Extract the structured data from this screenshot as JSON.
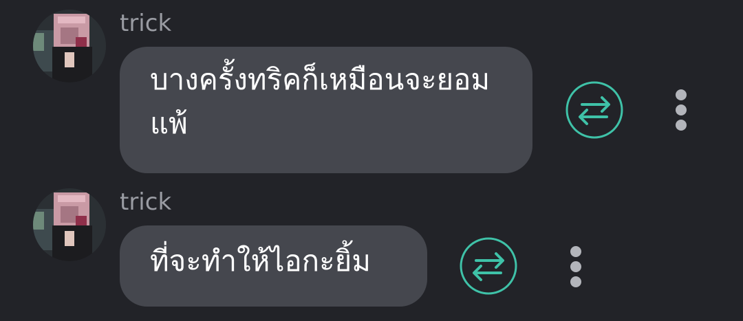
{
  "messages": [
    {
      "sender": "trick",
      "text": "บางครั้งทริคก็เหมือนจะยอมแพ้"
    },
    {
      "sender": "trick",
      "text": "ที่จะทำให้ไอกะยิ้ม"
    }
  ],
  "icons": {
    "avatar": "avatar-image",
    "translate": "translate-arrows-icon",
    "more": "more-vertical-icon"
  },
  "colors": {
    "background": "#222328",
    "bubble": "#45474e",
    "accent": "#3fc2a8",
    "sender": "#9a9ca3"
  }
}
